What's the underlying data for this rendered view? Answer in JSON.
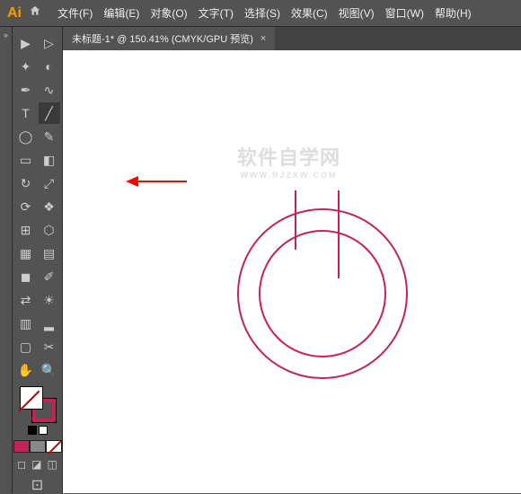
{
  "app_logo": "Ai",
  "menu": {
    "file": "文件(F)",
    "edit": "编辑(E)",
    "object": "对象(O)",
    "type": "文字(T)",
    "select": "选择(S)",
    "effect": "效果(C)",
    "view": "视图(V)",
    "window": "窗口(W)",
    "help": "帮助(H)"
  },
  "tab": {
    "title": "未标题-1* @ 150.41% (CMYK/GPU 预览)",
    "close": "×"
  },
  "watermark": {
    "main": "软件自学网",
    "sub": "WWW.RJZXW.COM"
  },
  "colors": {
    "stroke": "#c4225a",
    "swatch1": "#c4225a",
    "swatch2": "#888888",
    "swatch3_diag": "#c00"
  },
  "tool_glyphs": {
    "selection": "▶",
    "direct": "▷",
    "wand": "✦",
    "lasso": "◐",
    "pen": "✒",
    "curve": "∿",
    "type": "T",
    "line": "╱",
    "ellipse": "◯",
    "brush": "✎",
    "rect": "▭",
    "eraser": "◧",
    "rotate": "↻",
    "scale": "⤢",
    "width": "⟳",
    "warp": "❖",
    "free": "⊞",
    "shape": "⬡",
    "perspective": "▦",
    "mesh": "▤",
    "gradient": "◼",
    "eyedrop": "✐",
    "blend": "⇄",
    "symbol": "☀",
    "graph": "▥",
    "chart": "▂",
    "artboard": "▢",
    "slice": "✂",
    "hand": "✋",
    "zoom": "🔍"
  }
}
